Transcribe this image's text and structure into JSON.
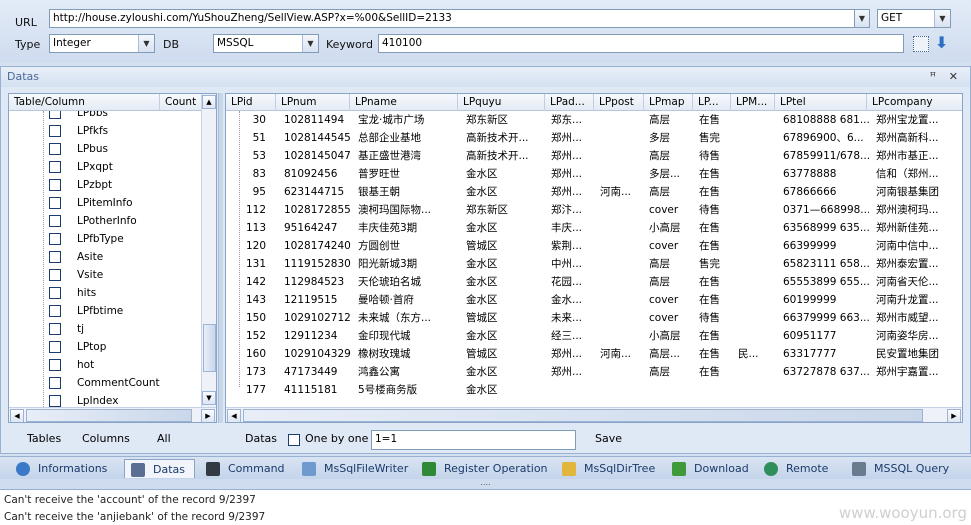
{
  "top": {
    "url_label": "URL",
    "url_value": "http://house.zyloushi.com/YuShouZheng/SellView.ASP?x=%00&SellID=2133",
    "method": "GET",
    "type_label": "Type",
    "type_value": "Integer",
    "db_label": "DB",
    "db_value": "MSSQL",
    "keyword_label": "Keyword",
    "keyword_value": "410100"
  },
  "pane": {
    "title": "Datas",
    "pin": "ꟸ",
    "close": "✕"
  },
  "left": {
    "col1": "Table/Column",
    "col2": "Count",
    "items": [
      "LPbbs",
      "LPfkfs",
      "LPbus",
      "LPxqpt",
      "LPzbpt",
      "LPitemInfo",
      "LPotherInfo",
      "LPfbType",
      "Asite",
      "Vsite",
      "hits",
      "LPfbtime",
      "tj",
      "LPtop",
      "hot",
      "CommentCount",
      "LpIndex"
    ],
    "buttons": [
      "Tables",
      "Columns",
      "All"
    ]
  },
  "grid": {
    "headers": [
      "LPid",
      "LPnum",
      "LPname",
      "LPquyu",
      "LPad...",
      "LPpost",
      "LPmap",
      "LP...",
      "LPM...",
      "LPtel",
      "LPcompany"
    ],
    "rows": [
      [
        "30",
        "102811494",
        "宝龙·城市广场",
        "郑东新区",
        "郑东...",
        "",
        "高层",
        "在售",
        "",
        "68108888 681...",
        "郑州宝龙置..."
      ],
      [
        "51",
        "1028144545",
        "总部企业基地",
        "高新技术开...",
        "郑州...",
        "",
        "多层",
        "售完",
        "",
        "67896900、6...",
        "郑州高新科..."
      ],
      [
        "53",
        "1028145047",
        "基正盛世港湾",
        "高新技术开...",
        "郑州...",
        "",
        "高层",
        "待售",
        "",
        "67859911/678...",
        "郑州市基正..."
      ],
      [
        "83",
        "81092456",
        "普罗旺世",
        "金水区",
        "郑州...",
        "",
        "多层...",
        "在售",
        "",
        "63778888",
        "信和（郑州..."
      ],
      [
        "95",
        "623144715",
        "银基王朝",
        "金水区",
        "郑州...",
        "河南...",
        "高层",
        "在售",
        "",
        "67866666",
        "河南银基集团"
      ],
      [
        "112",
        "1028172855",
        "澳柯玛国际物...",
        "郑东新区",
        "郑汴...",
        "",
        "cover",
        "待售",
        "",
        "0371—668998...",
        "郑州澳柯玛..."
      ],
      [
        "113",
        "95164247",
        "丰庆佳苑3期",
        "金水区",
        "丰庆...",
        "",
        "小高层",
        "在售",
        "",
        "63568999 635...",
        "郑州新佳苑..."
      ],
      [
        "120",
        "1028174240",
        "方圆创世",
        "管城区",
        "紫荆...",
        "",
        "cover",
        "在售",
        "",
        "66399999",
        "河南中信中..."
      ],
      [
        "131",
        "1119152830",
        "阳光新城3期",
        "金水区",
        "中州...",
        "",
        "高层",
        "售完",
        "",
        "65823111 658...",
        "郑州泰宏置..."
      ],
      [
        "142",
        "112984523",
        "天伦琥珀名城",
        "金水区",
        "花园...",
        "",
        "高层",
        "在售",
        "",
        "65553899 655...",
        "河南省天伦..."
      ],
      [
        "143",
        "12119515",
        "曼哈顿·首府",
        "金水区",
        "金水...",
        "",
        "cover",
        "在售",
        "",
        "60199999",
        "河南升龙置..."
      ],
      [
        "150",
        "1029102712",
        "未来城（东方...",
        "管城区",
        "未来...",
        "",
        "cover",
        "待售",
        "",
        "66379999 663...",
        "郑州市威望..."
      ],
      [
        "152",
        "12911234",
        "金印现代城",
        "金水区",
        "经三...",
        "",
        "小高层",
        "在售",
        "",
        "60951177",
        "河南姿华房..."
      ],
      [
        "160",
        "1029104329",
        "橡树玫瑰城",
        "管城区",
        "郑州...",
        "河南...",
        "高层...",
        "在售",
        "民...",
        "63317777",
        "民安置地集团"
      ],
      [
        "173",
        "47173449",
        "鸿鑫公寓",
        "金水区",
        "郑州...",
        "",
        "高层",
        "在售",
        "",
        "63727878 637...",
        "郑州宇嘉置..."
      ],
      [
        "177",
        "41115181",
        "5号楼商务版",
        "金水区",
        "",
        "",
        "",
        "",
        "",
        "",
        ""
      ]
    ]
  },
  "bottom": {
    "datas_label": "Datas",
    "one_by_one": "One by one",
    "filter": "1=1",
    "save": "Save"
  },
  "tabs": [
    {
      "label": "Informations",
      "icon": "info-icon",
      "color": "#3a78c8"
    },
    {
      "label": "Datas",
      "icon": "database-icon",
      "color": "#5a6f92"
    },
    {
      "label": "Command",
      "icon": "terminal-icon",
      "color": "#333a44"
    },
    {
      "label": "MsSqlFileWriter",
      "icon": "file-write-icon",
      "color": "#6e9ad0"
    },
    {
      "label": "Register Operation",
      "icon": "registry-icon",
      "color": "#2f8a36"
    },
    {
      "label": "MsSqlDirTree",
      "icon": "folder-icon",
      "color": "#e2b53c"
    },
    {
      "label": "Download",
      "icon": "download-icon",
      "color": "#3f9a3a"
    },
    {
      "label": "Remote",
      "icon": "globe-icon",
      "color": "#2e8f5a"
    },
    {
      "label": "MSSQL Query",
      "icon": "sql-icon",
      "color": "#6b7b8f"
    }
  ],
  "log": {
    "lines": [
      "Can't receive the 'account' of the record 9/2397",
      "Can't receive the 'anjiebank' of the record 9/2397"
    ],
    "watermark": "www.wooyun.org"
  }
}
